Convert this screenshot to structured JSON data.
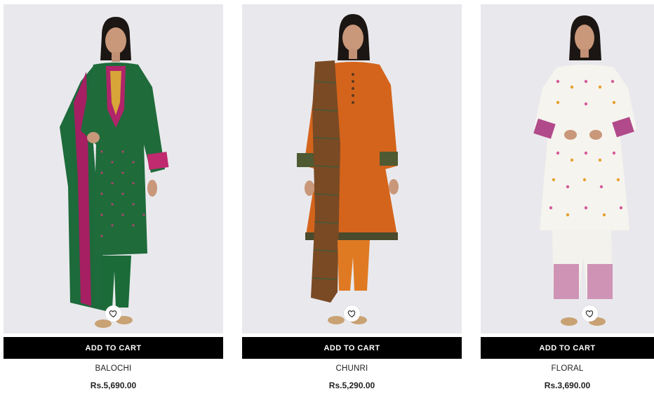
{
  "products": [
    {
      "name": "BALOCHI",
      "price": "Rs.5,690.00",
      "cta": "ADD TO CART",
      "image_icon": "product-photo-green-embroidered-suit",
      "colors": {
        "dress": "#1f6b3a",
        "accent": "#b0246a"
      }
    },
    {
      "name": "CHUNRI",
      "price": "Rs.5,290.00",
      "cta": "ADD TO CART",
      "image_icon": "product-photo-orange-printed-suit",
      "colors": {
        "dress": "#d4641c",
        "accent": "#5a4a2a"
      }
    },
    {
      "name": "FLORAL",
      "price": "Rs.3,690.00",
      "cta": "ADD TO CART",
      "image_icon": "product-photo-white-floral-suit",
      "colors": {
        "dress": "#f6f4ee",
        "accent": "#b14a8a"
      }
    }
  ],
  "wishlist_icon": "heart-icon",
  "theme": {
    "button_bg": "#000000",
    "button_text": "#ffffff",
    "photo_bg": "#e9e9ed"
  }
}
